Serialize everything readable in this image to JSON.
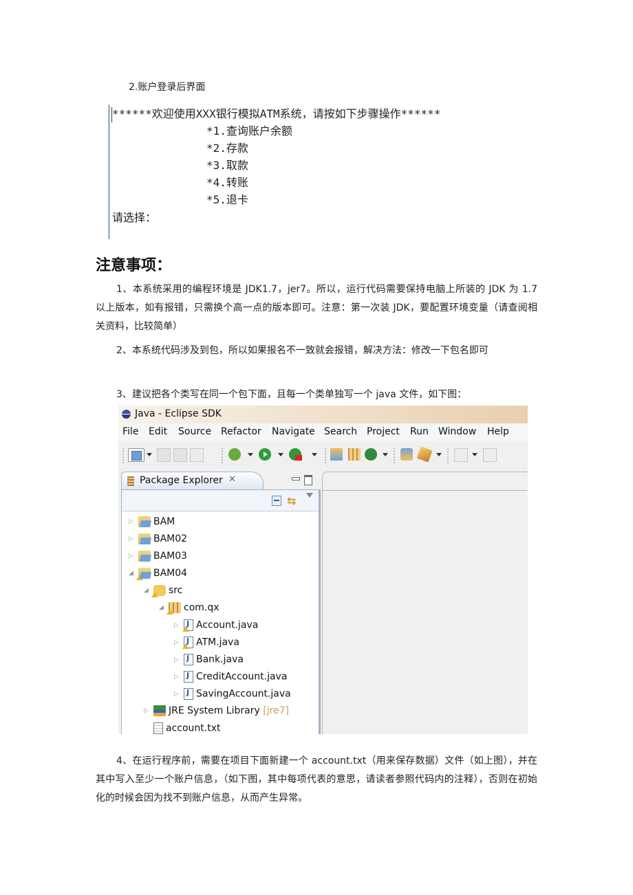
{
  "sub_heading": "2.账户登录后界面",
  "console": {
    "lines": [
      "******欢迎使用XXX银行模拟ATM系统，请按如下步骤操作******",
      "*1.查询账户余额",
      "*2.存款",
      "*3.取款",
      "*4.转账",
      "*5.退卡"
    ],
    "prompt": "请选择："
  },
  "notes": {
    "title": "注意事项：",
    "items": [
      "1、本系统采用的编程环境是 JDK1.7，jer7。所以，运行代码需要保持电脑上所装的 JDK 为 1.7 以上版本，如有报错，只需换个高一点的版本即可。注意：第一次装 JDK，要配置环境变量（请查阅相关资料，比较简单）",
      "2、本系统代码涉及到包，所以如果报名不一致就会报错，解决方法：修改一下包名即可",
      "3、建议把各个类写在同一个包下面，且每一个类单独写一个 java 文件，如下图：",
      "4、在运行程序前，需要在项目下面新建一个 account.txt（用来保存数据）文件（如上图），并在其中写入至少一个账户信息，（如下图，其中每项代表的意思，请读者参照代码内的注释），否则在初始化的时候会因为找不到账户信息，从而产生异常。"
    ]
  },
  "eclipse": {
    "window_title": "Java - Eclipse SDK",
    "menu": [
      "File",
      "Edit",
      "Source",
      "Refactor",
      "Navigate",
      "Search",
      "Project",
      "Run",
      "Window",
      "Help"
    ],
    "toolbar_icons": [
      "new-wizard-icon",
      "save-icon",
      "save-all-icon",
      "print-icon",
      "debug-icon",
      "run-icon",
      "external-tools-icon",
      "new-java-project-icon",
      "new-package-icon",
      "new-class-icon",
      "open-type-icon",
      "search-icon",
      "next-annotation-icon",
      "previous-annotation-icon"
    ],
    "package_explorer": {
      "tab_label": "Package Explorer",
      "close_glyph": "✕",
      "tree": [
        {
          "label": "BAM",
          "icon": "project-folder-icon",
          "expanded": false,
          "depth": 0
        },
        {
          "label": "BAM02",
          "icon": "project-folder-icon",
          "expanded": false,
          "depth": 0
        },
        {
          "label": "BAM03",
          "icon": "project-folder-icon",
          "expanded": false,
          "depth": 0
        },
        {
          "label": "BAM04",
          "icon": "project-folder-icon",
          "expanded": true,
          "depth": 0,
          "warning": true
        },
        {
          "label": "src",
          "icon": "source-folder-icon",
          "expanded": true,
          "depth": 1,
          "warning": true
        },
        {
          "label": "com.qx",
          "icon": "package-icon",
          "expanded": true,
          "depth": 2,
          "warning": true
        },
        {
          "label": "Account.java",
          "icon": "java-file-icon",
          "expanded": false,
          "depth": 3,
          "warning": true
        },
        {
          "label": "ATM.java",
          "icon": "java-file-icon",
          "expanded": false,
          "depth": 3,
          "warning": true
        },
        {
          "label": "Bank.java",
          "icon": "java-file-icon",
          "expanded": false,
          "depth": 3
        },
        {
          "label": "CreditAccount.java",
          "icon": "java-file-icon",
          "expanded": false,
          "depth": 3
        },
        {
          "label": "SavingAccount.java",
          "icon": "java-file-icon",
          "expanded": false,
          "depth": 3
        },
        {
          "label": "JRE System Library",
          "decoration": "[jre7]",
          "icon": "library-icon",
          "expanded": false,
          "depth": 1
        },
        {
          "label": "account.txt",
          "icon": "text-file-icon",
          "depth": 1,
          "leaf": true
        }
      ]
    }
  }
}
